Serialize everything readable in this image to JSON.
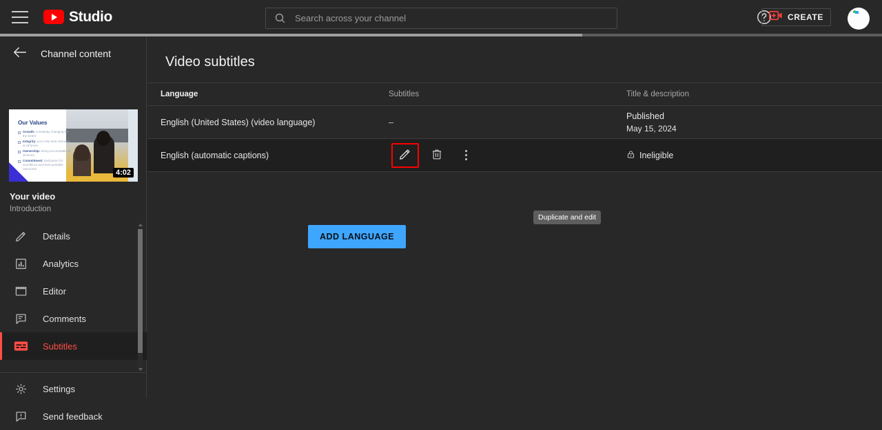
{
  "topbar": {
    "menu_icon": "hamburger-icon",
    "brand": "Studio",
    "logo_icon": "youtube-logo-icon",
    "search": {
      "placeholder": "Search across your channel",
      "value": "",
      "icon": "search-icon"
    },
    "help_icon": "help-circle-icon",
    "create": {
      "label": "CREATE",
      "icon": "video-plus-icon"
    },
    "avatar": "account-avatar"
  },
  "progress": {
    "percent": 66
  },
  "sidebar": {
    "back_label": "Channel content",
    "back_icon": "arrow-left-icon",
    "thumbnail": {
      "title": "Our Values",
      "duration": "4:02",
      "bullets": [
        {
          "bold": "Growth:",
          "text": " constantly changing for the better"
        },
        {
          "bold": "Integrity:",
          "text": " act in the best interests at all times"
        },
        {
          "bold": "Ownership:",
          "text": " being accountable at all times"
        },
        {
          "bold": "Commitment:",
          "text": " dedication for excellence and best possible outcomes"
        }
      ]
    },
    "video_title": "Your video",
    "video_subtitle": "Introduction",
    "items": [
      {
        "label": "Details",
        "icon": "pencil-icon",
        "active": false
      },
      {
        "label": "Analytics",
        "icon": "bar-chart-icon",
        "active": false
      },
      {
        "label": "Editor",
        "icon": "film-clapper-icon",
        "active": false
      },
      {
        "label": "Comments",
        "icon": "comment-icon",
        "active": false
      },
      {
        "label": "Subtitles",
        "icon": "subtitles-icon",
        "active": true
      }
    ],
    "bottom_items": [
      {
        "label": "Settings",
        "icon": "gear-icon"
      },
      {
        "label": "Send feedback",
        "icon": "feedback-icon"
      }
    ]
  },
  "main": {
    "page_title": "Video subtitles",
    "table": {
      "columns": [
        "Language",
        "Subtitles",
        "Title & description"
      ],
      "rows": [
        {
          "language": "English (United States) (video language)",
          "subtitles": "–",
          "status": "Published",
          "status_sub": "May 15, 2024",
          "status_icon": "",
          "hovered": false,
          "has_actions": false
        },
        {
          "language": "English (automatic captions)",
          "subtitles": "",
          "status": "Ineligible",
          "status_sub": "",
          "status_icon": "lock-icon",
          "hovered": true,
          "has_actions": true,
          "actions": [
            {
              "name": "edit-button",
              "icon": "pencil-icon",
              "focused": true
            },
            {
              "name": "delete-button",
              "icon": "trash-icon",
              "focused": false
            },
            {
              "name": "more-options-button",
              "icon": "kebab-icon",
              "focused": false
            }
          ]
        }
      ]
    },
    "tooltip": "Duplicate and edit",
    "add_language_label": "ADD LANGUAGE"
  },
  "colors": {
    "accent_blue": "#3ea6ff",
    "brand_red": "#ff0000",
    "active_red": "#ff4e45",
    "bg": "#282828",
    "row_hover": "#1f1f1f"
  }
}
